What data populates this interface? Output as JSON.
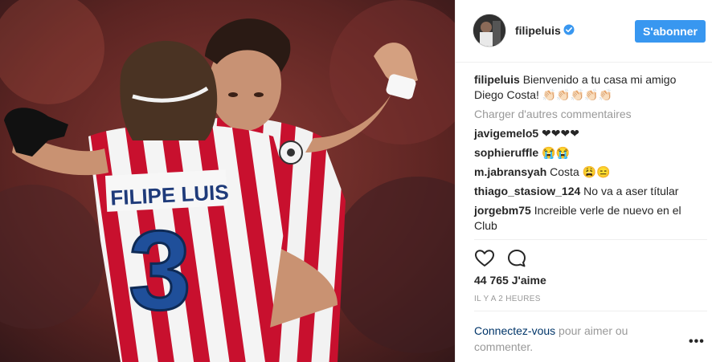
{
  "post": {
    "username": "filipeluis",
    "follow_label": "S'abonner",
    "caption_user": "filipeluis",
    "caption_text": "Bienvenido a tu casa mi amigo Diego Costa! 👏🏻👏🏻👏🏻👏🏻👏🏻",
    "load_more": "Charger d'autres commentaires",
    "comments": [
      {
        "user": "javigemelo5",
        "text": "❤❤❤❤"
      },
      {
        "user": "sophieruffle",
        "text": "😭😭"
      },
      {
        "user": "m.jabransyah",
        "text": "Costa 😩😑"
      },
      {
        "user": "thiago_stasiow_124",
        "text": "No va a aser títular"
      },
      {
        "user": "jorgebm75",
        "text": "Increible verle de nuevo en el Club"
      }
    ],
    "likes": "44 765 J'aime",
    "time_ago": "IL Y A 2 HEURES",
    "login_link": "Connectez-vous",
    "login_text": " pour aimer ou commenter.",
    "more_label": "•••"
  },
  "photo": {
    "jersey_name": "FILIPE LUIS",
    "jersey_number": "3"
  },
  "icons": {
    "like": "heart-icon",
    "comment": "comment-icon",
    "verified": "verified-badge-icon",
    "more": "more-options-icon"
  },
  "colors": {
    "accent": "#3897f0",
    "link": "#003569",
    "muted": "#999999",
    "text": "#262626",
    "jersey_red": "#c8102e"
  }
}
